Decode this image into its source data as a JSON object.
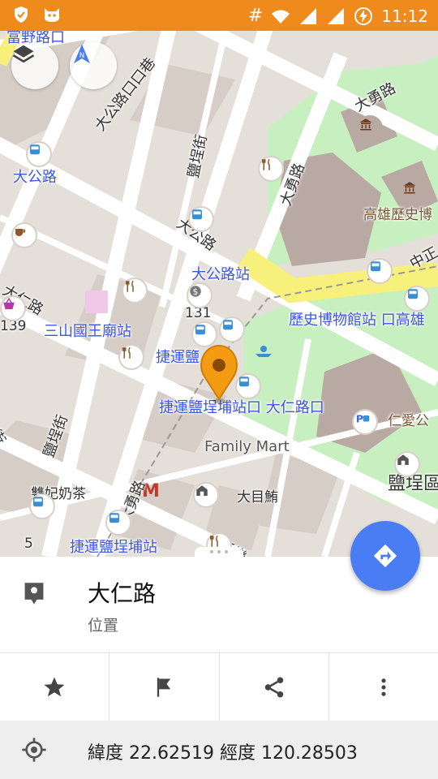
{
  "status_bar": {
    "time": "11:12",
    "extra_symbol": "#"
  },
  "map": {
    "labels": {
      "fuye_rd": "富野路口",
      "dagong_lane": "大公路口口巷",
      "yancheng_st_top": "鹽埕街",
      "dayong_rd_top": "大勇路",
      "dayong_rd_mid": "大勇路",
      "dagong_rd_label": "大公路",
      "dagong_rd_road": "大公路",
      "dagong_station": "大公路站",
      "museum_label": "高雄歷史博",
      "zhongzheng": "中正",
      "daren_rd_left": "大仁路",
      "num_139": "139",
      "num_131": "131",
      "sanshan_temple": "三山國王廟站",
      "history_museum_station": "歷史博物館站 口高雄",
      "mrt_yancheng_short": "捷運鹽",
      "mrt_yancheng_daren": "捷運鹽埕埔站口 大仁路口",
      "ren_ai_park": "仁愛公",
      "family_mart": "Family Mart",
      "yancheng_big": "鹽埕區",
      "yue_st": "樂街",
      "yancheng_st_bottom": "鹽埕街",
      "shuangfei_tea": "雙妃奶茶",
      "dayong_rd_bottom": "大勇路",
      "damu_fish": "大目鮪",
      "num_5": "5",
      "mrt_yancheng_bottom": "捷運鹽埕埔站",
      "xinle": "新樂"
    }
  },
  "bottom_sheet": {
    "title": "大仁路",
    "subtitle": "位置",
    "coordinates": "緯度 22.62519 經度 120.28503",
    "actions": [
      "star-icon",
      "flag-icon",
      "share-icon",
      "more-vert-icon"
    ]
  },
  "colors": {
    "status_bar": "#ef8a1c",
    "accent": "#4a7cf3",
    "marker": "#f39c12",
    "park": "#c8f0c0",
    "road_major": "#f7f07a"
  }
}
